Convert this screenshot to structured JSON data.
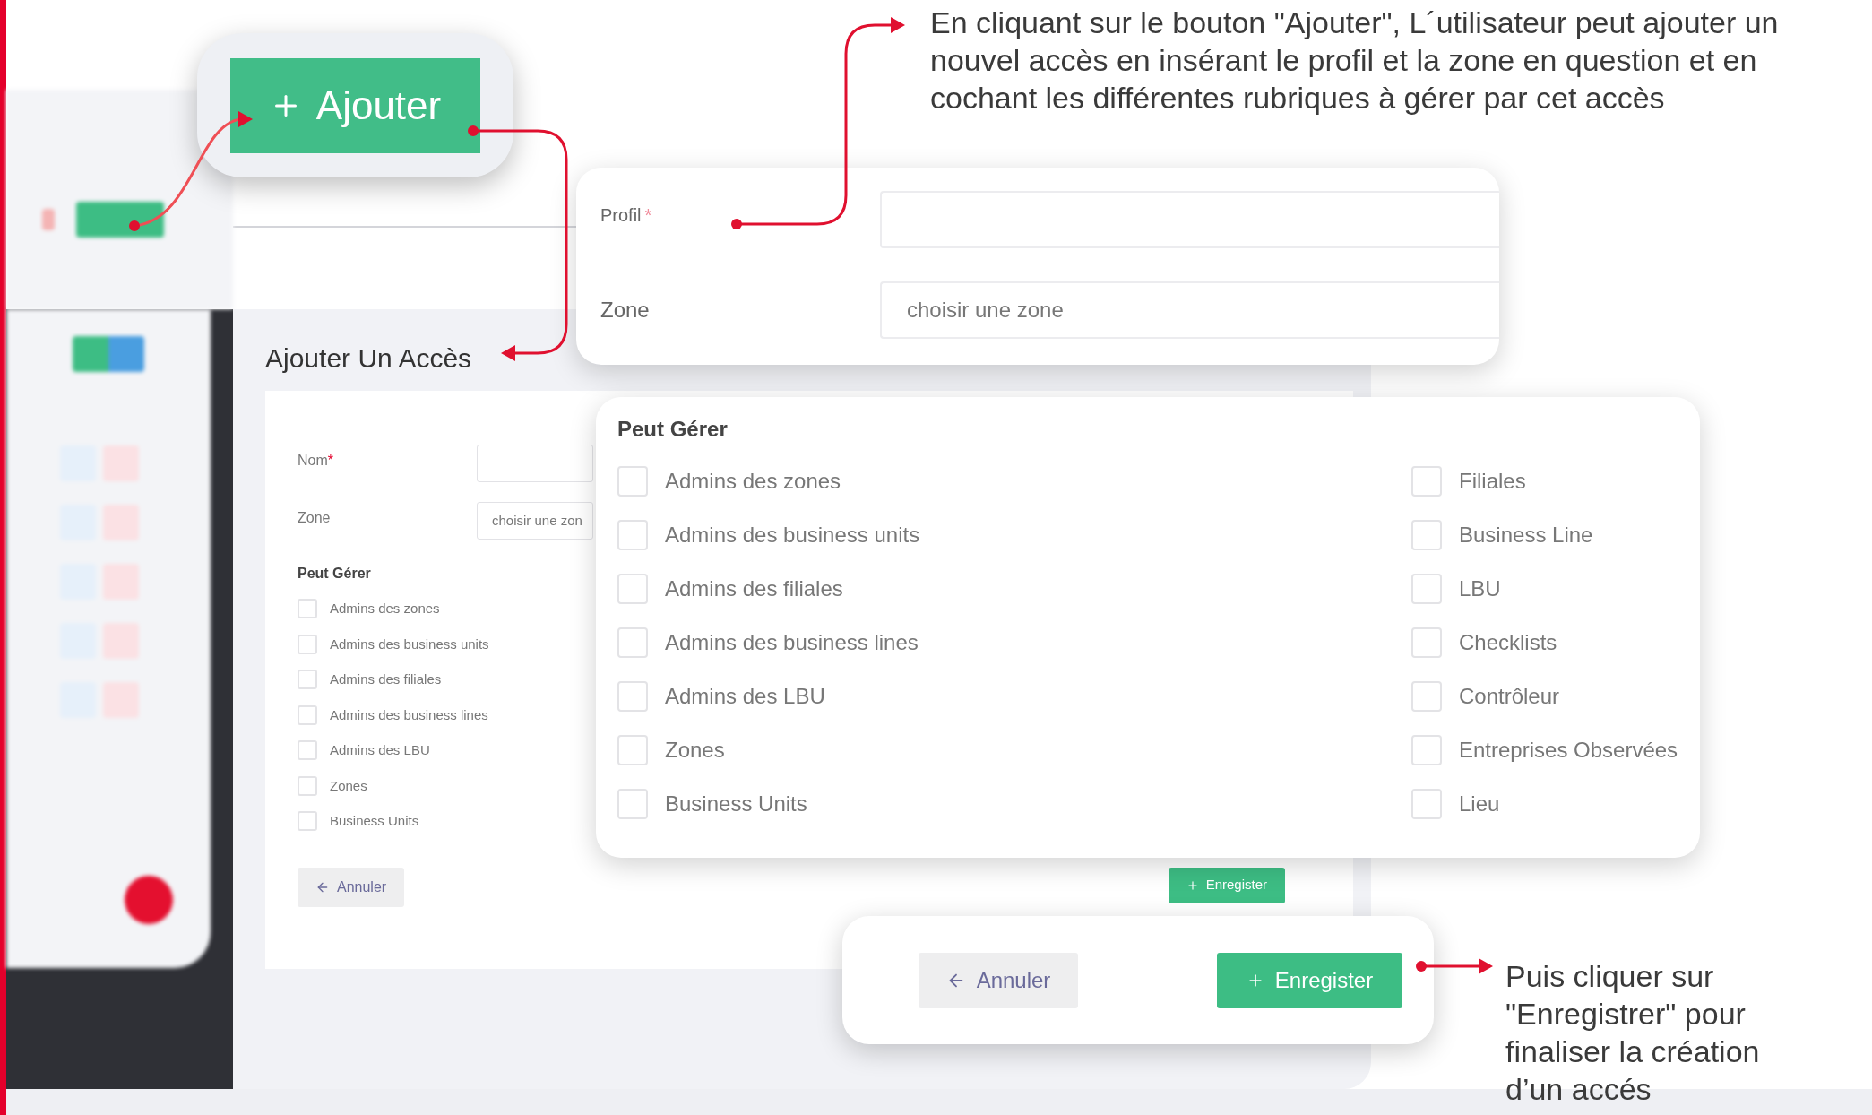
{
  "add_button_callout": {
    "label": "Ajouter"
  },
  "top_note": "En cliquant sur le bouton \"Ajouter\", L´utilisateur peut ajouter un nouvel accès en insérant le profil et la zone en question et en cochant les différentes rubriques à gérer par cet accès",
  "page": {
    "title": "Ajouter Un Accès",
    "form": {
      "fields": [
        {
          "label": "Nom",
          "required_mark": "*"
        },
        {
          "label": "Zone",
          "placeholder": "choisir une zon"
        }
      ],
      "section_title": "Peut Gérer",
      "options": [
        {
          "label": "Admins des zones",
          "checked": false
        },
        {
          "label": "Admins des business units",
          "checked": false
        },
        {
          "label": "Admins des filiales",
          "checked": false
        },
        {
          "label": "Admins des business lines",
          "checked": false
        },
        {
          "label": "Admins des LBU",
          "checked": false
        },
        {
          "label": "Zones",
          "checked": false
        },
        {
          "label": "Business Units",
          "checked": false
        }
      ],
      "cancel_button": {
        "label": "Annuler"
      },
      "save_button": {
        "label": "Enregister"
      }
    }
  },
  "profile_callout": {
    "fields": [
      {
        "label": "Profil",
        "required_mark": "*"
      },
      {
        "label": "Zone",
        "placeholder": "choisir une zone"
      }
    ]
  },
  "permissions_callout": {
    "title": "Peut Gérer",
    "columns": [
      {
        "options": [
          {
            "label": "Admins des zones",
            "checked": false
          },
          {
            "label": "Admins des business units",
            "checked": false
          },
          {
            "label": "Admins des filiales",
            "checked": false
          },
          {
            "label": "Admins des business lines",
            "checked": false
          },
          {
            "label": "Admins des LBU",
            "checked": false
          },
          {
            "label": "Zones",
            "checked": false
          },
          {
            "label": "Business Units",
            "checked": false
          }
        ]
      },
      {
        "options": [
          {
            "label": "Filiales",
            "checked": false
          },
          {
            "label": "Business Line",
            "checked": false
          },
          {
            "label": "LBU",
            "checked": false
          },
          {
            "label": "Checklists",
            "checked": false
          },
          {
            "label": "Contrôleur",
            "checked": false
          },
          {
            "label": "Entreprises Observées",
            "checked": false
          },
          {
            "label": "Lieu",
            "checked": false
          }
        ]
      }
    ]
  },
  "save_callout": {
    "cancel_button": {
      "label": "Annuler"
    },
    "save_button": {
      "label": "Enregister"
    }
  },
  "bottom_note": "Puis cliquer sur \"Enregistrer\" pour finaliser la création d’un accés"
}
